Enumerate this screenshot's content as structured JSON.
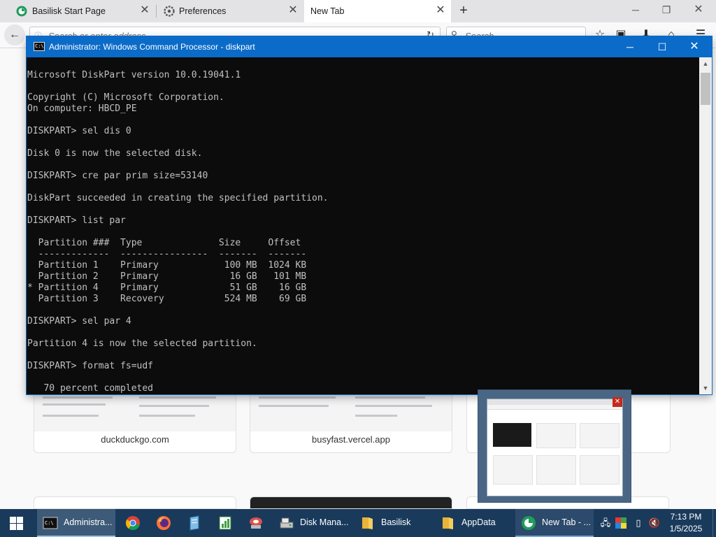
{
  "browser": {
    "tabs": [
      {
        "label": "Basilisk Start Page",
        "icon": "basilisk-icon",
        "active": false
      },
      {
        "label": "Preferences",
        "icon": "gear-icon",
        "active": false
      },
      {
        "label": "New Tab",
        "icon": "",
        "active": true
      }
    ],
    "new_tab_label": "+",
    "url_placeholder": "Search or enter address",
    "search_placeholder": "Search"
  },
  "page": {
    "tiles": [
      {
        "label": "duckduckgo.com"
      },
      {
        "label": "busyfast.vercel.app"
      }
    ]
  },
  "cmd": {
    "title": "Administrator: Windows Command Processor - diskpart",
    "output": "Microsoft DiskPart version 10.0.19041.1\n\nCopyright (C) Microsoft Corporation.\nOn computer: HBCD_PE\n\nDISKPART> sel dis 0\n\nDisk 0 is now the selected disk.\n\nDISKPART> cre par prim size=53140\n\nDiskPart succeeded in creating the specified partition.\n\nDISKPART> list par\n\n  Partition ###  Type              Size     Offset\n  -------------  ----------------  -------  -------\n  Partition 1    Primary            100 MB  1024 KB\n  Partition 2    Primary             16 GB   101 MB\n* Partition 4    Primary             51 GB    16 GB\n  Partition 3    Recovery           524 MB    69 GB\n\nDISKPART> sel par 4\n\nPartition 4 is now the selected partition.\n\nDISKPART> format fs=udf\n\n   70 percent completed"
  },
  "taskbar": {
    "items": [
      {
        "label": "Administra...",
        "icon": "cmd-icon",
        "state": "active"
      },
      {
        "label": "Disk Mana...",
        "icon": "disk-management-icon",
        "state": "normal"
      },
      {
        "label": "Basilisk",
        "icon": "folder-icon",
        "state": "normal"
      },
      {
        "label": "AppData",
        "icon": "folder-icon",
        "state": "normal"
      },
      {
        "label": "New Tab - ...",
        "icon": "basilisk-icon",
        "state": "open"
      }
    ],
    "pinned": [
      "chrome-icon",
      "firefox-icon",
      "notepad-icon",
      "spreadsheet-icon",
      "hdd-icon"
    ],
    "clock": {
      "time": "7:13 PM",
      "date": "1/5/2025"
    }
  },
  "colors": {
    "cmd_titlebar": "#0b6bc8",
    "taskbar": "#1a3a5c",
    "cmd_bg": "#0c0c0c",
    "cmd_text": "#c0c0c0"
  }
}
